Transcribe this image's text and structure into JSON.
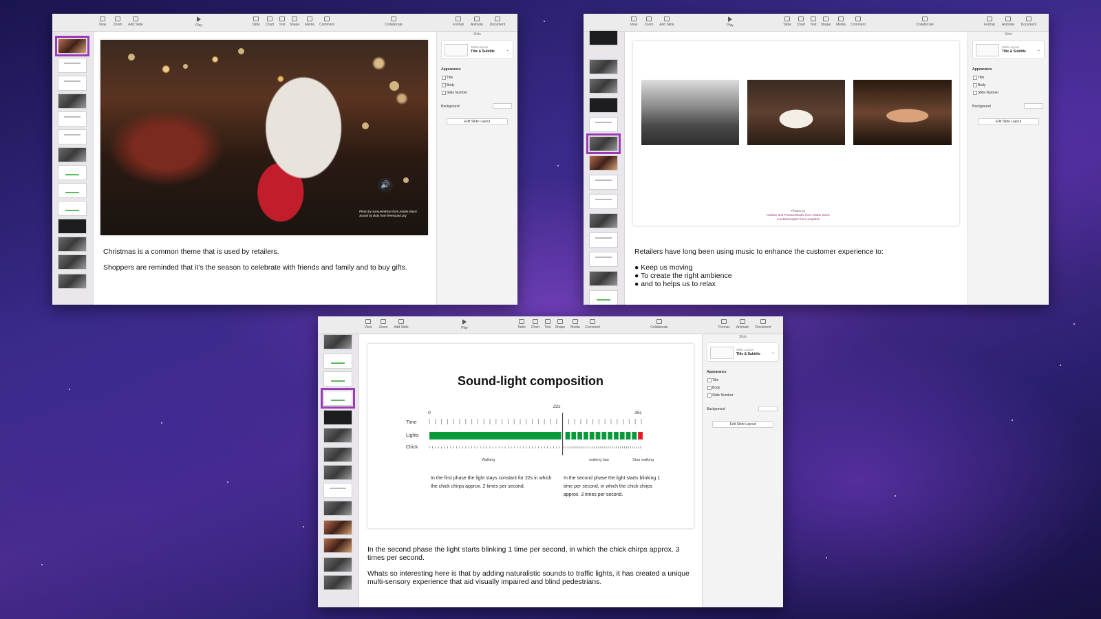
{
  "toolbar": {
    "view": "View",
    "zoom": "Zoom",
    "add_slide": "Add Slide",
    "play": "Play",
    "table": "Table",
    "chart": "Chart",
    "text": "Text",
    "shape": "Shape",
    "media": "Media",
    "comment": "Comment",
    "collaborate": "Collaborate",
    "format": "Format",
    "animate": "Animate",
    "document": "Document"
  },
  "inspector": {
    "tab_label": "Slide",
    "layout_label": "Slide Layout",
    "layout_value": "Title & Subtitle",
    "appearance": "Appearance",
    "checks": [
      "Title",
      "Body",
      "Slide Number"
    ],
    "background": "Background",
    "edit_button": "Edit Slide Layout"
  },
  "window1": {
    "photo_credit_line1": "Photo by SamuelAkhan from Adobe Stock",
    "photo_credit_line2": "Sound by Bula from freesound.org",
    "sound_icon": "speaker-icon",
    "notes": [
      "Christmas is a common theme that is used by retailers.",
      "Shoppers are reminded that it’s the season to celebrate with friends and family and to buy gifts."
    ]
  },
  "window2": {
    "credit_line1": "Photos by",
    "credit_line2": "Kakiore and Prostockstudio from Adobe Stock",
    "credit_line3": "Joe Blackington from Unsplash",
    "notes_intro": "Retailers have long been using music to enhance the customer experience to:",
    "bullets": [
      "Keep us moving",
      "To create the right ambience",
      "and to helps us to relax"
    ]
  },
  "window3": {
    "chart_data": {
      "type": "timeline",
      "title": "Sound-light composition",
      "time_ticks": [
        "0",
        "22s",
        "35s"
      ],
      "time_values": [
        0,
        22,
        35
      ],
      "rows": [
        "Time",
        "Lights",
        "Chick"
      ],
      "phase_labels": [
        "Walking",
        "walking fast",
        "Stop walking"
      ],
      "phase1": {
        "start": 0,
        "end": 22,
        "light": "constant",
        "chirps_per_second": 2
      },
      "phase2": {
        "start": 22,
        "end": 35,
        "light": "blinking 1 time per second",
        "chirps_per_second": 3
      },
      "colors": {
        "green": "#0a9a3c",
        "red": "#e01c24"
      },
      "descriptions": [
        "In the first phase the light stays constant for 22s in which the chick chirps approx. 2 times per second.",
        "In the second phase the light starts blinking 1 time per second, in which the chick chirps approx. 3 times per second."
      ]
    },
    "notes": [
      "In the second phase the light starts blinking 1 time per second, in which the chick chirps approx. 3 times per second.",
      "Whats so interesting here is that by adding naturalistic sounds to traffic lights, it has created a unique multi-sensory experience that aid visually impaired and blind pedestrians."
    ]
  }
}
